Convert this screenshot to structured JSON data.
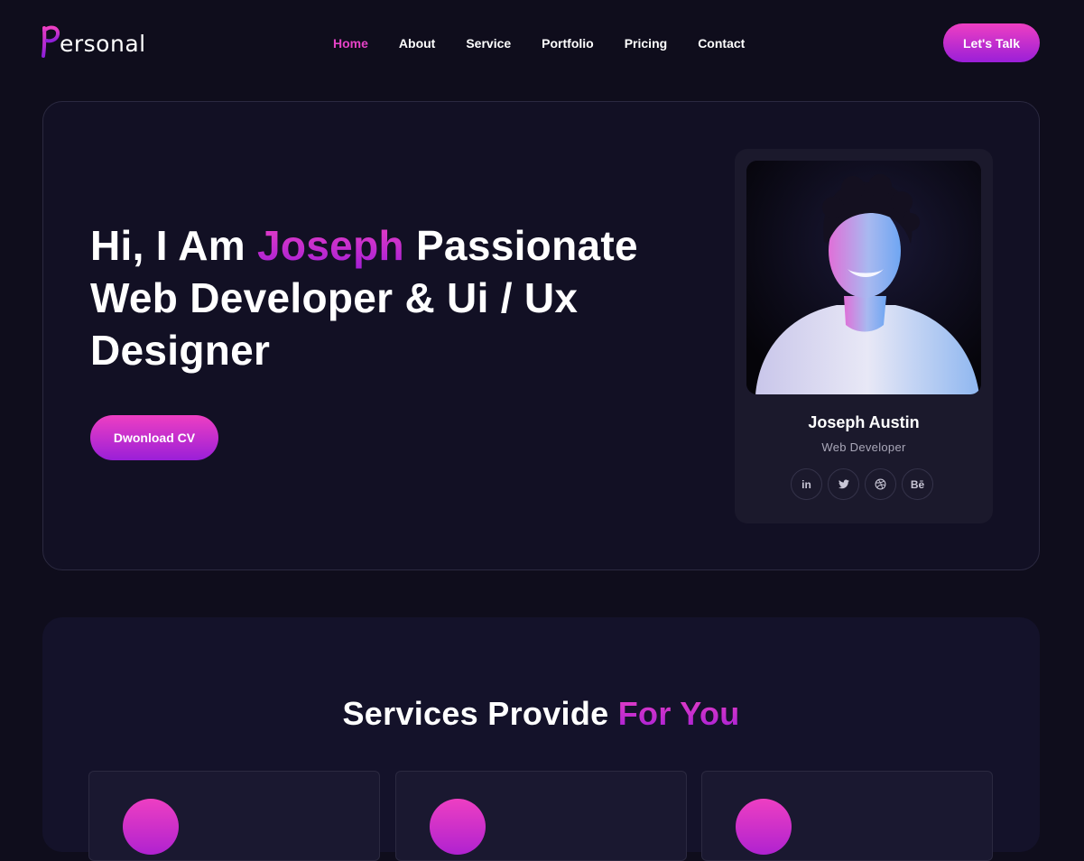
{
  "brand": {
    "logo_letter": "P",
    "logo_text": "ersonal",
    "accent_color": "#e542c6"
  },
  "nav": {
    "items": [
      {
        "label": "Home",
        "active": true
      },
      {
        "label": "About",
        "active": false
      },
      {
        "label": "Service",
        "active": false
      },
      {
        "label": "Portfolio",
        "active": false
      },
      {
        "label": "Pricing",
        "active": false
      },
      {
        "label": "Contact",
        "active": false
      }
    ],
    "cta_label": "Let's Talk"
  },
  "hero": {
    "title_part1": "Hi, I Am ",
    "title_highlight": "Joseph",
    "title_part2": " Passionate Web Developer & Ui / Ux Designer",
    "cv_button_label": "Dwonload CV"
  },
  "profile": {
    "name": "Joseph Austin",
    "role": "Web Developer",
    "socials": [
      {
        "icon": "linkedin-icon",
        "glyph": "in"
      },
      {
        "icon": "twitter-icon",
        "glyph": ""
      },
      {
        "icon": "dribbble-icon",
        "glyph": ""
      },
      {
        "icon": "behance-icon",
        "glyph": "Bē"
      }
    ]
  },
  "services": {
    "title_part1": "Services Provide ",
    "title_highlight": "For You"
  }
}
